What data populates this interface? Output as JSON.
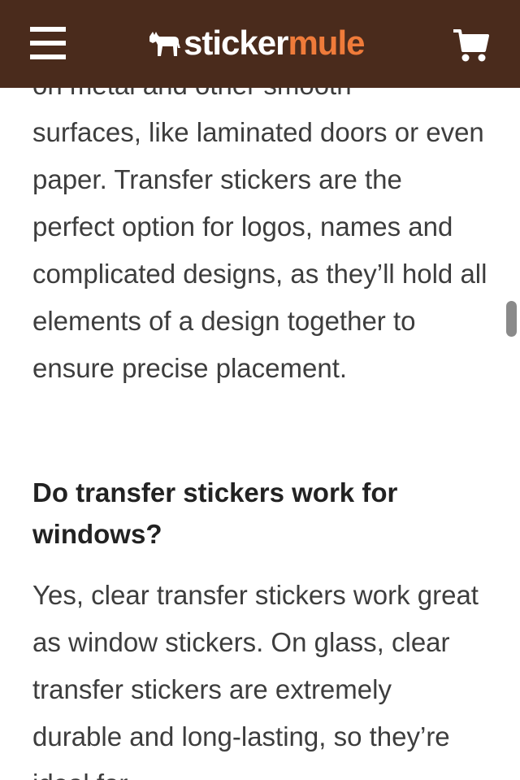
{
  "header": {
    "logo_sticker": "sticker",
    "logo_mule": "mule",
    "menu_icon": "hamburger-menu-icon",
    "cart_icon": "shopping-cart-icon",
    "background_color": "#4a2b1c",
    "accent_color": "#ef7b3a"
  },
  "content": {
    "partial_line": "on metal and other smooth",
    "paragraph_1": "surfaces, like laminated doors or even paper. Transfer stickers are the perfect option for logos, names and complicated designs, as they’ll hold all elements of a design together to ensure precise placement.",
    "heading": "Do transfer stickers work for windows?",
    "paragraph_2": "Yes, clear transfer stickers work great as window stickers. On glass, clear transfer stickers are extremely durable and long-lasting, so they’re ideal for"
  }
}
